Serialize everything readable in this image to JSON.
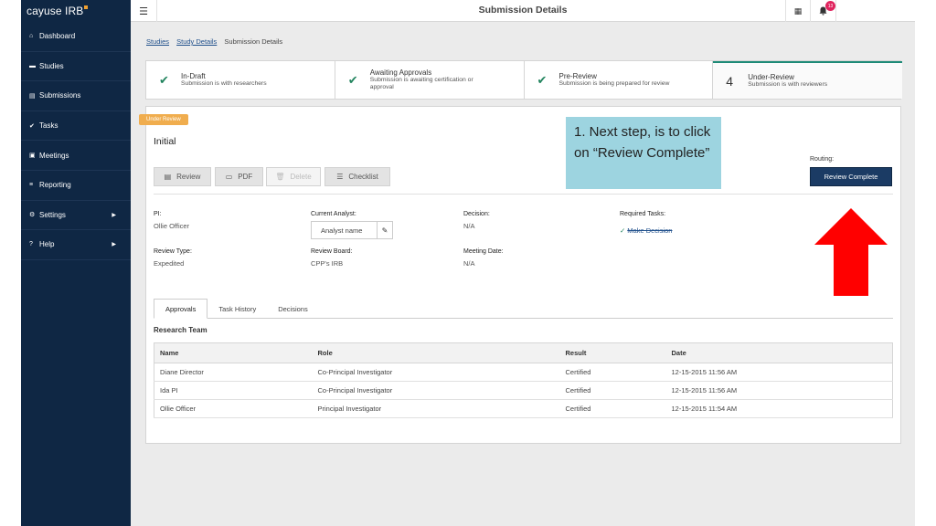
{
  "brand": {
    "name": "cayuse IRB"
  },
  "sidebar": {
    "items": [
      {
        "icon": "home-icon",
        "glyph": "⌂",
        "label": "Dashboard"
      },
      {
        "icon": "folder-icon",
        "glyph": "▬",
        "label": "Studies"
      },
      {
        "icon": "document-icon",
        "glyph": "▤",
        "label": "Submissions"
      },
      {
        "icon": "check-icon",
        "glyph": "✔",
        "label": "Tasks"
      },
      {
        "icon": "calendar-icon",
        "glyph": "▣",
        "label": "Meetings"
      },
      {
        "icon": "list-icon",
        "glyph": "≡",
        "label": "Reporting"
      },
      {
        "icon": "gear-icon",
        "glyph": "⚙",
        "label": "Settings",
        "expand": "▶"
      },
      {
        "icon": "help-icon",
        "glyph": "?",
        "label": "Help",
        "expand": "▶"
      }
    ]
  },
  "topbar": {
    "title": "Submission Details",
    "notification_count": "13"
  },
  "breadcrumb": {
    "items": [
      "Studies",
      "Study Details"
    ],
    "current": "Submission Details"
  },
  "stepper": {
    "steps": [
      {
        "title": "In-Draft",
        "subtitle": "Submission is with researchers",
        "done": true
      },
      {
        "title": "Awaiting Approvals",
        "subtitle": "Submission is awaiting certification or approval",
        "done": true
      },
      {
        "title": "Pre-Review",
        "subtitle": "Submission is being prepared for review",
        "done": true
      },
      {
        "number": "4",
        "title": "Under-Review",
        "subtitle": "Submission is with reviewers",
        "done": false
      }
    ]
  },
  "panel": {
    "tag": "Under Review",
    "title": "Initial",
    "actions": {
      "review": "Review",
      "pdf": "PDF",
      "delete": "Delete",
      "checklist": "Checklist"
    },
    "routing_label": "Routing:",
    "review_complete": "Review Complete",
    "fields": {
      "pi_label": "PI:",
      "pi_value": "Ollie Officer",
      "analyst_label": "Current Analyst:",
      "analyst_value": "Analyst name",
      "decision_label": "Decision:",
      "decision_value": "N/A",
      "tasks_label": "Required Tasks:",
      "task_value": "Make Decision",
      "review_type_label": "Review Type:",
      "review_type_value": "Expedited",
      "board_label": "Review Board:",
      "board_value": "CPP's IRB",
      "meeting_label": "Meeting Date:",
      "meeting_value": "N/A"
    },
    "tabs": [
      "Approvals",
      "Task History",
      "Decisions"
    ],
    "section_title": "Research Team",
    "table": {
      "headers": [
        "Name",
        "Role",
        "Result",
        "Date"
      ],
      "rows": [
        [
          "Diane Director",
          "Co-Principal Investigator",
          "Certified",
          "12-15-2015 11:56 AM"
        ],
        [
          "Ida PI",
          "Co-Principal Investigator",
          "Certified",
          "12-15-2015 11:56 AM"
        ],
        [
          "Ollie Officer",
          "Principal Investigator",
          "Certified",
          "12-15-2015 11:54 AM"
        ]
      ]
    }
  },
  "annotation": {
    "callout": "1. Next step, is to click on “Review Complete”",
    "arrow_color": "#ff0000",
    "callout_color": "#9dd4e0"
  },
  "colors": {
    "sidebar": "#0f2744",
    "primary_button": "#1b3b64",
    "tag": "#f0ad4e",
    "check": "#22845e"
  }
}
